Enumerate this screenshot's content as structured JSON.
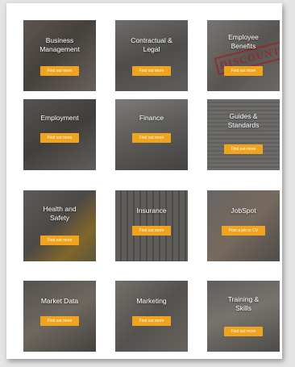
{
  "tiles": [
    {
      "title_lines": [
        "Business",
        "Management"
      ],
      "button": "Find out more"
    },
    {
      "title_lines": [
        "Contractual &",
        "Legal"
      ],
      "button": "Find out more"
    },
    {
      "title_lines": [
        "Employee",
        "Benefits"
      ],
      "button": "Find out more",
      "stamp": "DISCOUNT"
    },
    {
      "title_lines": [
        "Employment"
      ],
      "button": "Find out more"
    },
    {
      "title_lines": [
        "Finance"
      ],
      "button": "Find out more"
    },
    {
      "title_lines": [
        "Guides &",
        "Standards"
      ],
      "button": "Find out more"
    },
    {
      "title_lines": [
        "Health and",
        "Safety"
      ],
      "button": "Find out more"
    },
    {
      "title_lines": [
        "Insurance"
      ],
      "button": "Find out more"
    },
    {
      "title_lines": [
        "JobSpot"
      ],
      "button": "Post a job or CV"
    },
    {
      "title_lines": [
        "Market Data"
      ],
      "button": "Find out more"
    },
    {
      "title_lines": [
        "Marketing"
      ],
      "button": "Find out more"
    },
    {
      "title_lines": [
        "Training &",
        "Skills"
      ],
      "button": "Find out more"
    }
  ],
  "colors": {
    "button": "#f0a31d",
    "page_bg": "#e4e4e4",
    "card_bg": "#ffffff"
  }
}
